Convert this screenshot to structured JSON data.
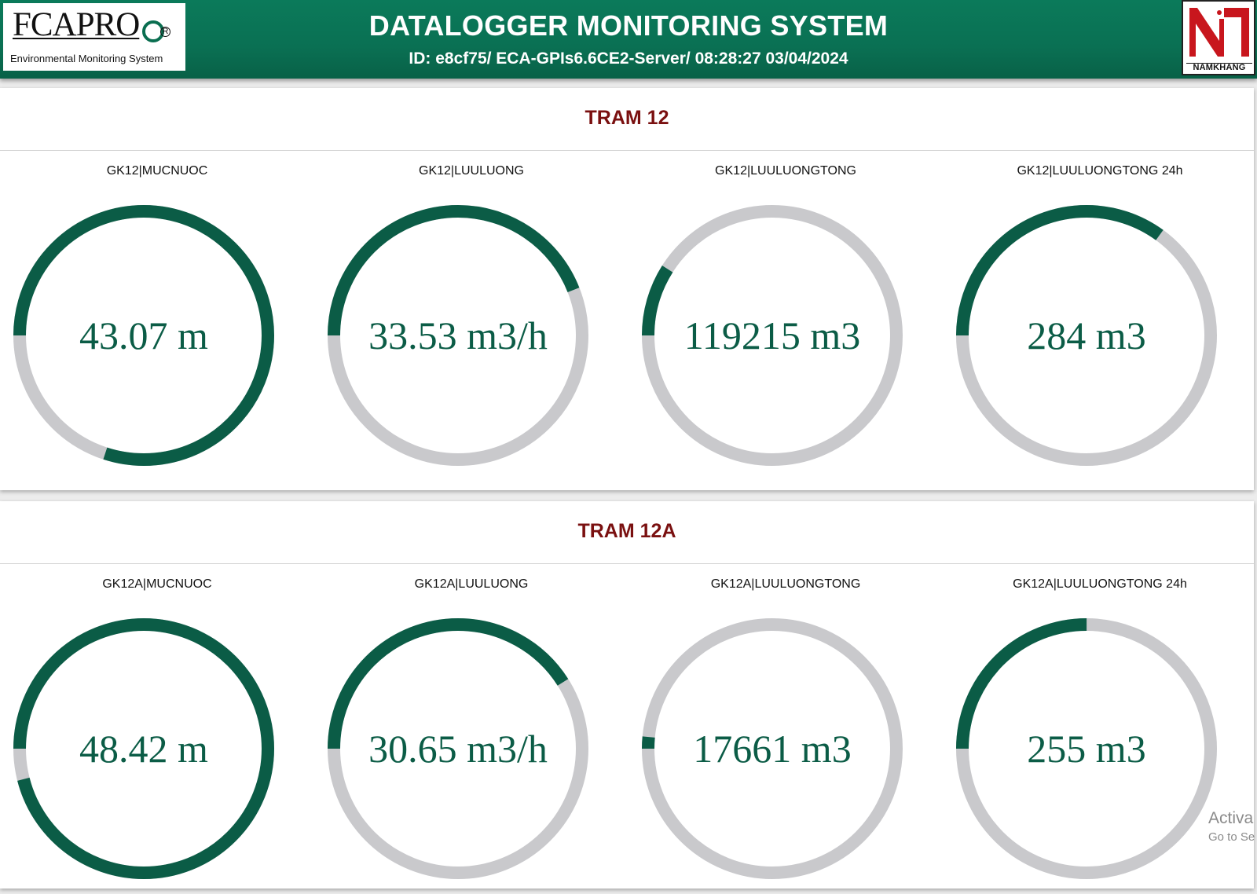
{
  "header": {
    "brand_name": "FCAPRO",
    "brand_reg": "R",
    "brand_subtitle": "Environmental Monitoring System",
    "title": "DATALOGGER MONITORING SYSTEM",
    "subtitle": "ID: e8cf75/ ECA-GPIs6.6CE2-Server/ 08:28:27 03/04/2024",
    "partner_name": "NAMKHANG"
  },
  "colors": {
    "header_green": "#0a7053",
    "gauge_fill": "#0b5c46",
    "gauge_track": "#c9c9cc",
    "station_title": "#7a1010"
  },
  "stations": [
    {
      "title": "TRAM 12",
      "gauges": [
        {
          "label": "GK12|MUCNUOC",
          "value": "43.07 m",
          "fill": 0.8
        },
        {
          "label": "GK12|LUULUONG",
          "value": "33.53 m3/h",
          "fill": 0.44
        },
        {
          "label": "GK12|LUULUONGTONG",
          "value": "119215 m3",
          "fill": 0.09
        },
        {
          "label": "GK12|LUULUONGTONG 24h",
          "value": "284 m3",
          "fill": 0.35
        }
      ]
    },
    {
      "title": "TRAM 12A",
      "gauges": [
        {
          "label": "GK12A|MUCNUOC",
          "value": "48.42 m",
          "fill": 0.96
        },
        {
          "label": "GK12A|LUULUONG",
          "value": "30.65 m3/h",
          "fill": 0.41
        },
        {
          "label": "GK12A|LUULUONGTONG",
          "value": "17661 m3",
          "fill": 0.015
        },
        {
          "label": "GK12A|LUULUONGTONG 24h",
          "value": "255 m3",
          "fill": 0.25
        }
      ]
    }
  ],
  "watermark": {
    "line1": "Activa",
    "line2": "Go to Se"
  }
}
